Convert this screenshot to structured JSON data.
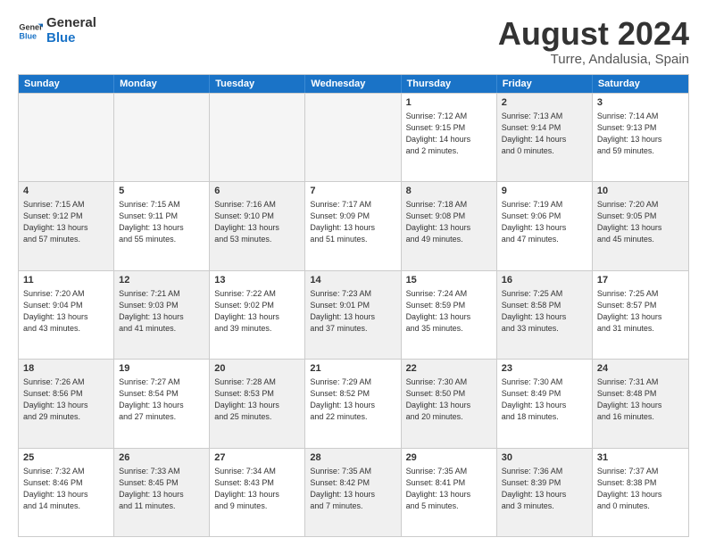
{
  "logo": {
    "line1": "General",
    "line2": "Blue"
  },
  "title": "August 2024",
  "subtitle": "Turre, Andalusia, Spain",
  "header": {
    "days": [
      "Sunday",
      "Monday",
      "Tuesday",
      "Wednesday",
      "Thursday",
      "Friday",
      "Saturday"
    ]
  },
  "weeks": [
    {
      "cells": [
        {
          "day": "",
          "content": "",
          "empty": true
        },
        {
          "day": "",
          "content": "",
          "empty": true
        },
        {
          "day": "",
          "content": "",
          "empty": true
        },
        {
          "day": "",
          "content": "",
          "empty": true
        },
        {
          "day": "1",
          "content": "Sunrise: 7:12 AM\nSunset: 9:15 PM\nDaylight: 14 hours\nand 2 minutes.",
          "shaded": false
        },
        {
          "day": "2",
          "content": "Sunrise: 7:13 AM\nSunset: 9:14 PM\nDaylight: 14 hours\nand 0 minutes.",
          "shaded": true
        },
        {
          "day": "3",
          "content": "Sunrise: 7:14 AM\nSunset: 9:13 PM\nDaylight: 13 hours\nand 59 minutes.",
          "shaded": false
        }
      ]
    },
    {
      "cells": [
        {
          "day": "4",
          "content": "Sunrise: 7:15 AM\nSunset: 9:12 PM\nDaylight: 13 hours\nand 57 minutes.",
          "shaded": true
        },
        {
          "day": "5",
          "content": "Sunrise: 7:15 AM\nSunset: 9:11 PM\nDaylight: 13 hours\nand 55 minutes.",
          "shaded": false
        },
        {
          "day": "6",
          "content": "Sunrise: 7:16 AM\nSunset: 9:10 PM\nDaylight: 13 hours\nand 53 minutes.",
          "shaded": true
        },
        {
          "day": "7",
          "content": "Sunrise: 7:17 AM\nSunset: 9:09 PM\nDaylight: 13 hours\nand 51 minutes.",
          "shaded": false
        },
        {
          "day": "8",
          "content": "Sunrise: 7:18 AM\nSunset: 9:08 PM\nDaylight: 13 hours\nand 49 minutes.",
          "shaded": true
        },
        {
          "day": "9",
          "content": "Sunrise: 7:19 AM\nSunset: 9:06 PM\nDaylight: 13 hours\nand 47 minutes.",
          "shaded": false
        },
        {
          "day": "10",
          "content": "Sunrise: 7:20 AM\nSunset: 9:05 PM\nDaylight: 13 hours\nand 45 minutes.",
          "shaded": true
        }
      ]
    },
    {
      "cells": [
        {
          "day": "11",
          "content": "Sunrise: 7:20 AM\nSunset: 9:04 PM\nDaylight: 13 hours\nand 43 minutes.",
          "shaded": false
        },
        {
          "day": "12",
          "content": "Sunrise: 7:21 AM\nSunset: 9:03 PM\nDaylight: 13 hours\nand 41 minutes.",
          "shaded": true
        },
        {
          "day": "13",
          "content": "Sunrise: 7:22 AM\nSunset: 9:02 PM\nDaylight: 13 hours\nand 39 minutes.",
          "shaded": false
        },
        {
          "day": "14",
          "content": "Sunrise: 7:23 AM\nSunset: 9:01 PM\nDaylight: 13 hours\nand 37 minutes.",
          "shaded": true
        },
        {
          "day": "15",
          "content": "Sunrise: 7:24 AM\nSunset: 8:59 PM\nDaylight: 13 hours\nand 35 minutes.",
          "shaded": false
        },
        {
          "day": "16",
          "content": "Sunrise: 7:25 AM\nSunset: 8:58 PM\nDaylight: 13 hours\nand 33 minutes.",
          "shaded": true
        },
        {
          "day": "17",
          "content": "Sunrise: 7:25 AM\nSunset: 8:57 PM\nDaylight: 13 hours\nand 31 minutes.",
          "shaded": false
        }
      ]
    },
    {
      "cells": [
        {
          "day": "18",
          "content": "Sunrise: 7:26 AM\nSunset: 8:56 PM\nDaylight: 13 hours\nand 29 minutes.",
          "shaded": true
        },
        {
          "day": "19",
          "content": "Sunrise: 7:27 AM\nSunset: 8:54 PM\nDaylight: 13 hours\nand 27 minutes.",
          "shaded": false
        },
        {
          "day": "20",
          "content": "Sunrise: 7:28 AM\nSunset: 8:53 PM\nDaylight: 13 hours\nand 25 minutes.",
          "shaded": true
        },
        {
          "day": "21",
          "content": "Sunrise: 7:29 AM\nSunset: 8:52 PM\nDaylight: 13 hours\nand 22 minutes.",
          "shaded": false
        },
        {
          "day": "22",
          "content": "Sunrise: 7:30 AM\nSunset: 8:50 PM\nDaylight: 13 hours\nand 20 minutes.",
          "shaded": true
        },
        {
          "day": "23",
          "content": "Sunrise: 7:30 AM\nSunset: 8:49 PM\nDaylight: 13 hours\nand 18 minutes.",
          "shaded": false
        },
        {
          "day": "24",
          "content": "Sunrise: 7:31 AM\nSunset: 8:48 PM\nDaylight: 13 hours\nand 16 minutes.",
          "shaded": true
        }
      ]
    },
    {
      "cells": [
        {
          "day": "25",
          "content": "Sunrise: 7:32 AM\nSunset: 8:46 PM\nDaylight: 13 hours\nand 14 minutes.",
          "shaded": false
        },
        {
          "day": "26",
          "content": "Sunrise: 7:33 AM\nSunset: 8:45 PM\nDaylight: 13 hours\nand 11 minutes.",
          "shaded": true
        },
        {
          "day": "27",
          "content": "Sunrise: 7:34 AM\nSunset: 8:43 PM\nDaylight: 13 hours\nand 9 minutes.",
          "shaded": false
        },
        {
          "day": "28",
          "content": "Sunrise: 7:35 AM\nSunset: 8:42 PM\nDaylight: 13 hours\nand 7 minutes.",
          "shaded": true
        },
        {
          "day": "29",
          "content": "Sunrise: 7:35 AM\nSunset: 8:41 PM\nDaylight: 13 hours\nand 5 minutes.",
          "shaded": false
        },
        {
          "day": "30",
          "content": "Sunrise: 7:36 AM\nSunset: 8:39 PM\nDaylight: 13 hours\nand 3 minutes.",
          "shaded": true
        },
        {
          "day": "31",
          "content": "Sunrise: 7:37 AM\nSunset: 8:38 PM\nDaylight: 13 hours\nand 0 minutes.",
          "shaded": false
        }
      ]
    }
  ]
}
